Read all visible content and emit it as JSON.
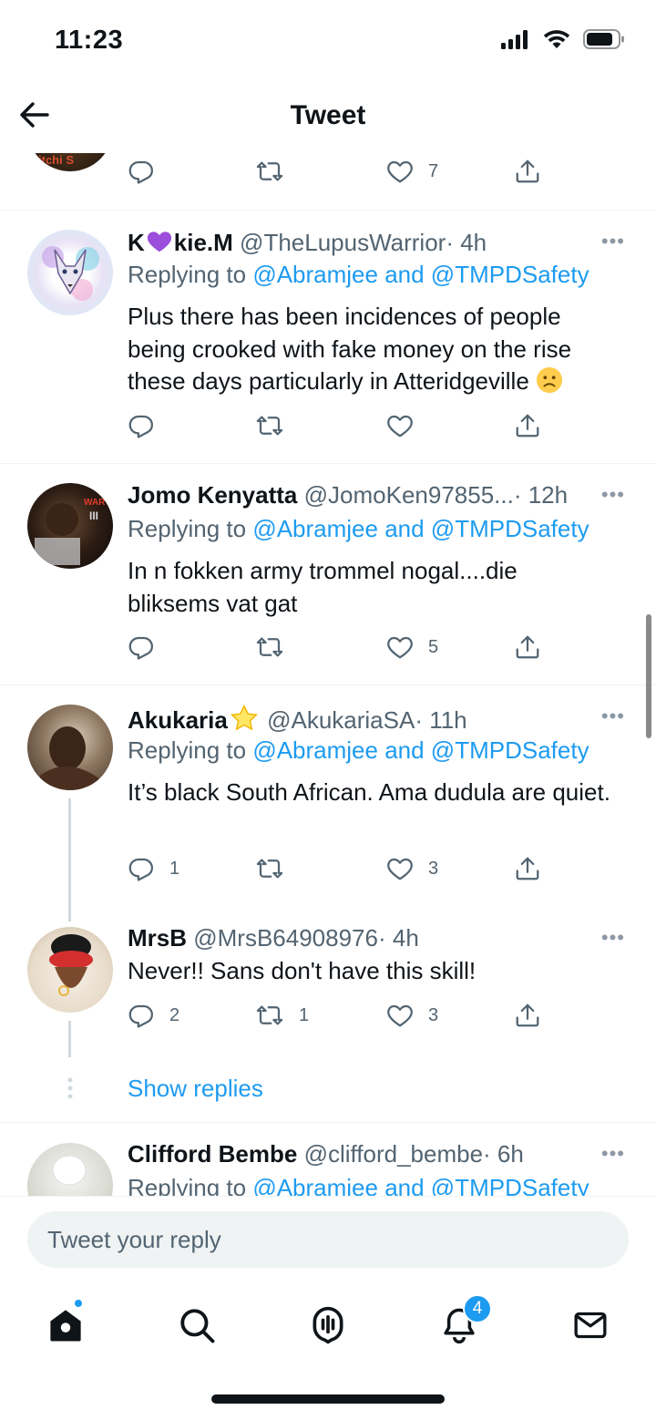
{
  "status": {
    "time": "11:23"
  },
  "header": {
    "title": "Tweet"
  },
  "top_actions": {
    "likes": "7"
  },
  "tweets": [
    {
      "name_a": "K",
      "name_b": "kie.M",
      "handle": "@TheLupusWarrior",
      "time": "· 4h",
      "replying_prefix": "Replying to ",
      "replying_to": "@Abramjee and @TMPDSafety",
      "text": "Plus there has been incidences of people being crooked with fake money on the rise these days particularly in Atteridgeville",
      "replies": "",
      "retweets": "",
      "likes": ""
    },
    {
      "name": "Jomo Kenyatta",
      "handle": "@JomoKen97855...",
      "time": "· 12h",
      "replying_prefix": "Replying to ",
      "replying_to": "@Abramjee and @TMPDSafety",
      "text": "In n fokken army trommel nogal....die bliksems vat gat",
      "replies": "",
      "retweets": "",
      "likes": "5"
    },
    {
      "name": "Akukaria",
      "handle": "@AkukariaSA",
      "time": "· 11h",
      "replying_prefix": "Replying to ",
      "replying_to": "@Abramjee and @TMPDSafety",
      "text": "It’s black South African. Ama dudula are quiet.",
      "replies": "1",
      "retweets": "",
      "likes": "3"
    },
    {
      "name": "MrsB",
      "handle": "@MrsB64908976",
      "time": "· 4h",
      "text": "Never!! Sans don't have this skill!",
      "replies": "2",
      "retweets": "1",
      "likes": "3"
    },
    {
      "name": "Clifford Bembe",
      "handle": "@clifford_bembe",
      "time": "· 6h",
      "replying_prefix": "Replying to ",
      "replying_to": "@Abramjee and @TMPDSafety"
    }
  ],
  "thread": {
    "show_replies": "Show replies"
  },
  "compose": {
    "placeholder": "Tweet your reply"
  },
  "tabs": {
    "notifications_badge": "4"
  },
  "colors": {
    "accent": "#1d9bf0",
    "text": "#0f1419",
    "muted": "#536471",
    "divider": "#eff3f4"
  }
}
